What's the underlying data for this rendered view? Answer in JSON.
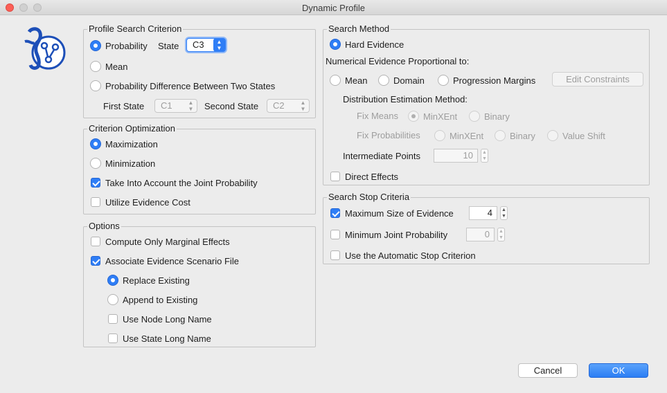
{
  "window": {
    "title": "Dynamic Profile"
  },
  "profile_search": {
    "title": "Profile Search Criterion",
    "probability_label": "Probability",
    "state_label": "State",
    "state_value": "C3",
    "mean_label": "Mean",
    "prob_diff_label": "Probability Difference Between Two States",
    "first_state_label": "First State",
    "first_state_value": "C1",
    "second_state_label": "Second State",
    "second_state_value": "C2"
  },
  "criterion_optimization": {
    "title": "Criterion Optimization",
    "maximization_label": "Maximization",
    "minimization_label": "Minimization",
    "joint_prob_label": "Take Into Account the Joint Probability",
    "evidence_cost_label": "Utilize Evidence Cost"
  },
  "options": {
    "title": "Options",
    "marginal_label": "Compute Only Marginal Effects",
    "associate_label": "Associate Evidence Scenario File",
    "replace_label": "Replace Existing",
    "append_label": "Append to Existing",
    "node_long_label": "Use Node Long Name",
    "state_long_label": "Use State Long Name"
  },
  "search_method": {
    "title": "Search Method",
    "hard_evidence_label": "Hard Evidence",
    "numerical_label": "Numerical Evidence Proportional to:",
    "mean_label": "Mean",
    "domain_label": "Domain",
    "progression_label": "Progression Margins",
    "edit_constraints_label": "Edit Constraints",
    "distribution_label": "Distribution Estimation Method:",
    "fix_means_label": "Fix Means",
    "minxent_label": "MinXEnt",
    "binary_label": "Binary",
    "fix_probs_label": "Fix Probabilities",
    "minxent2_label": "MinXEnt",
    "binary2_label": "Binary",
    "value_shift_label": "Value Shift",
    "intermediate_label": "Intermediate Points",
    "intermediate_value": "10",
    "direct_effects_label": "Direct Effects"
  },
  "stop_criteria": {
    "title": "Search Stop Criteria",
    "max_size_label": "Maximum Size of Evidence",
    "max_size_value": "4",
    "min_joint_label": "Minimum Joint Probability",
    "min_joint_value": "0",
    "automatic_label": "Use the Automatic Stop Criterion"
  },
  "footer": {
    "cancel_label": "Cancel",
    "ok_label": "OK"
  },
  "colors": {
    "accent": "#2f7ef6",
    "close": "#fc5f57"
  },
  "icons": {
    "logo": "bayesialab-logo-icon",
    "arrows": "up-down-chevron-icon"
  }
}
